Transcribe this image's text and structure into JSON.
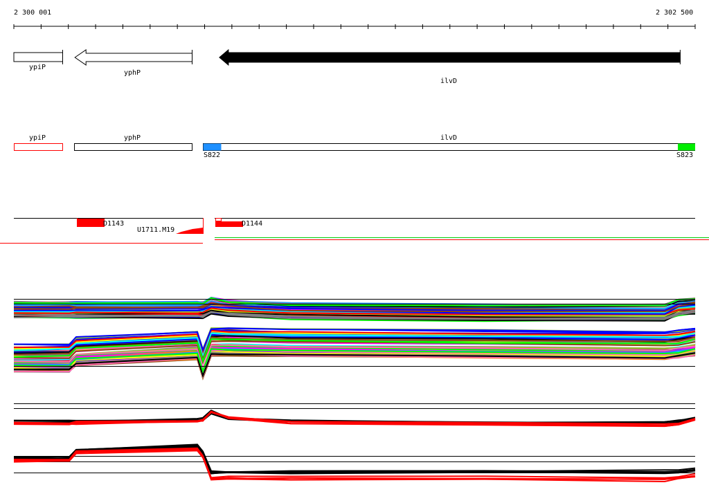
{
  "ruler": {
    "start_label": "2 300 001",
    "end_label": "2 302 500",
    "start": 2300001,
    "end": 2302500
  },
  "genes": [
    {
      "name": "ypiP",
      "start": 2300001,
      "end": 2300180,
      "strand": "+",
      "fill": "#ffffff"
    },
    {
      "name": "yphP",
      "start": 2300225,
      "end": 2300655,
      "strand": "-",
      "fill": "#ffffff"
    },
    {
      "name": "ilvD",
      "start": 2300755,
      "end": 2302445,
      "strand": "-",
      "fill": "#000000"
    }
  ],
  "transcripts": [
    {
      "name": "ypiP",
      "border": "#ff0000"
    },
    {
      "name": "yphP",
      "border": "#000000"
    },
    {
      "name": "ilvD",
      "border": "#000000"
    }
  ],
  "sites": [
    {
      "label": "S822",
      "color": "#1e90ff"
    },
    {
      "label": "S823",
      "color": "#00ee00"
    }
  ],
  "features": [
    {
      "label": "D1143"
    },
    {
      "label": "U1711.M19"
    },
    {
      "label": "D1144"
    }
  ],
  "colors": {
    "accent": "#ff0000",
    "line": "#000000"
  }
}
